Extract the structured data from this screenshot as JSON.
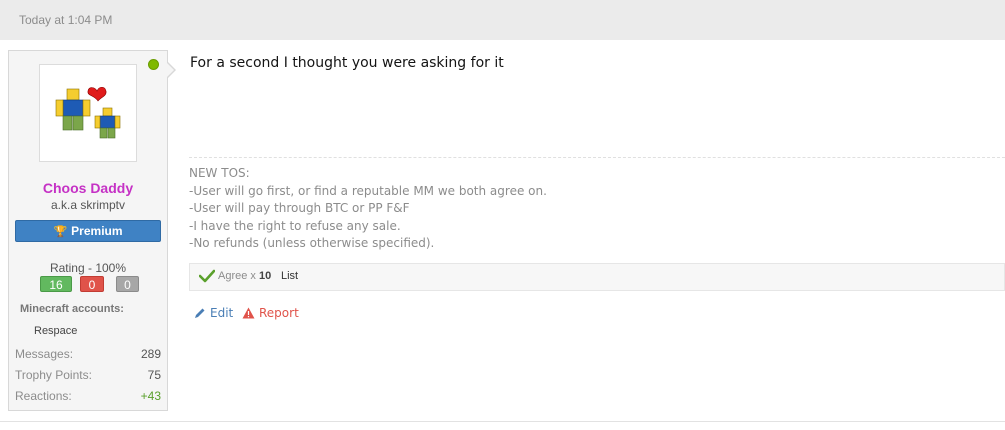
{
  "post": {
    "timestamp": "Today at 1:04 PM",
    "message": "For a second I thought you were asking for it",
    "signature": [
      "NEW TOS:",
      "-User will go first, or find a reputable MM we both agree on.",
      "-User will pay through BTC or PP F&F",
      "-I have the right to refuse any sale.",
      "-No refunds (unless otherwise specified)."
    ]
  },
  "user": {
    "name": "Choos Daddy",
    "aka": "a.k.a skrimptv",
    "badge": "Premium",
    "rating_label": "Rating - 100%",
    "rating_positive": "16",
    "rating_negative": "0",
    "rating_neutral": "0",
    "minecraft_label": "Minecraft accounts:",
    "minecraft_account": "Respace",
    "stats": [
      {
        "label": "Messages:",
        "value": "289"
      },
      {
        "label": "Trophy Points:",
        "value": "75"
      },
      {
        "label": "Reactions:",
        "value": "+43"
      }
    ],
    "online_color": "#7fb900",
    "name_color": "#c531c5",
    "avatar_icon": "roblox-avatar-icon"
  },
  "reactions": {
    "label": "Agree",
    "times": "x",
    "count": "10",
    "list": "List"
  },
  "actions": {
    "edit": "Edit",
    "report": "Report"
  },
  "colors": {
    "premium": "#3f82c4",
    "positive": "#62b95f",
    "negative": "#e0534a",
    "neutral": "#a7a7a7",
    "link": "#4a7eb5"
  }
}
